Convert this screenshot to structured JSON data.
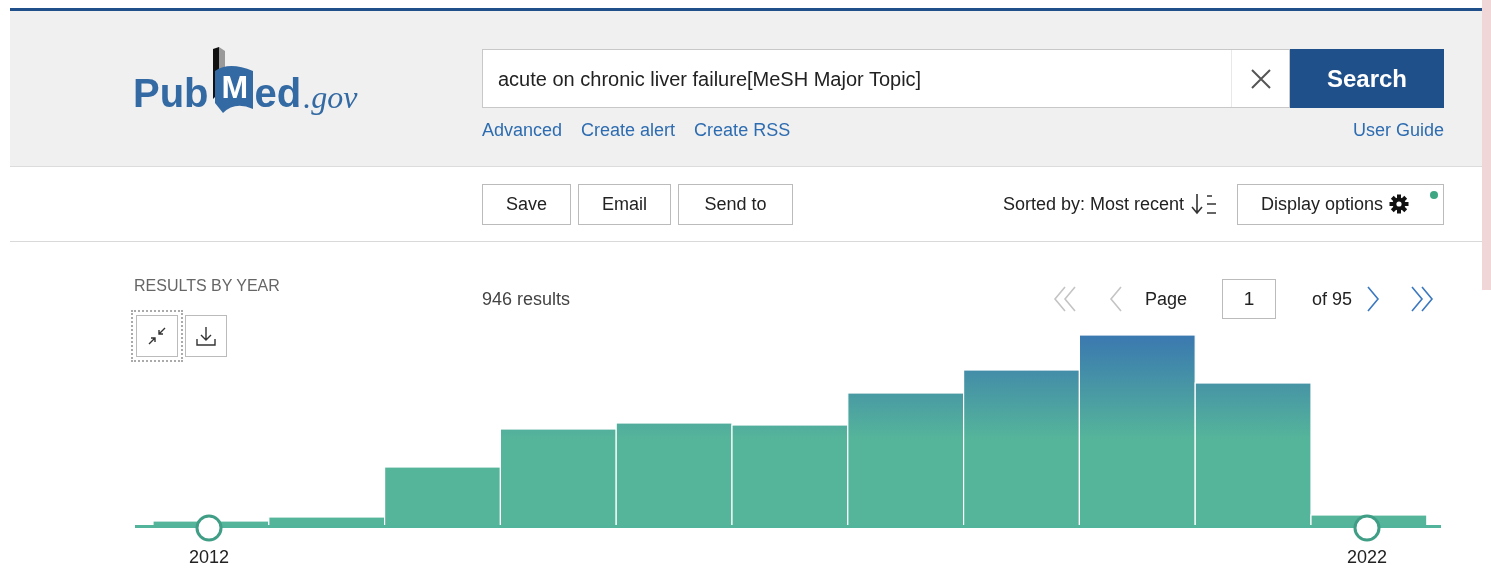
{
  "header": {
    "logo": {
      "text_1": "Pub",
      "book_letter": "M",
      "text_2": "ed",
      "suffix": ".gov"
    },
    "search": {
      "value": "acute on chronic liver failure[MeSH Major Topic]",
      "button": "Search"
    },
    "links": [
      "Advanced",
      "Create alert",
      "Create RSS"
    ],
    "user_guide": "User Guide"
  },
  "toolbar": {
    "buttons": [
      "Save",
      "Email",
      "Send to"
    ],
    "sort": "Sorted by: Most recent",
    "display_options": "Display options"
  },
  "results_by_year": {
    "title": "RESULTS BY YEAR",
    "start_year": "2012",
    "end_year": "2022"
  },
  "results": {
    "count": "946 results"
  },
  "pagination": {
    "nav": [
      {
        "kind": "first",
        "disabled": true
      },
      {
        "kind": "previous",
        "disabled": true
      },
      {
        "kind": "next",
        "disabled": false
      },
      {
        "kind": "last",
        "disabled": false
      }
    ],
    "page_label": "Page",
    "page": "1",
    "of": "of 95"
  }
}
